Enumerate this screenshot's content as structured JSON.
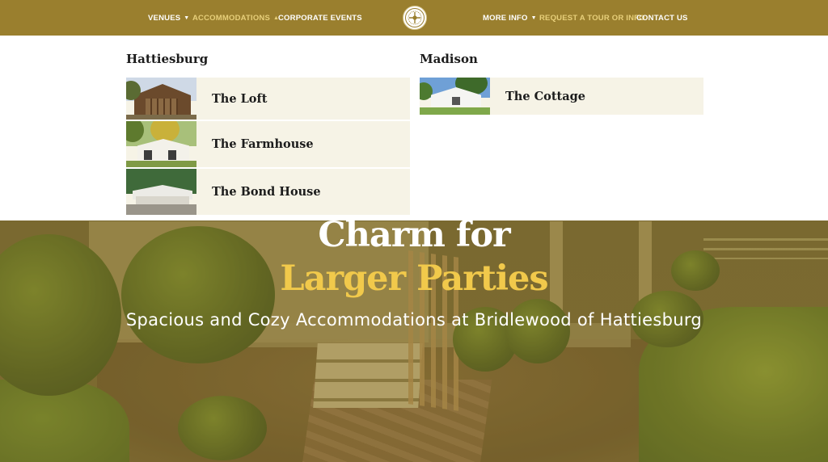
{
  "nav": {
    "left": [
      {
        "label": "VENUES",
        "caret": "▼"
      },
      {
        "label": "ACCOMMODATIONS",
        "caret": "▲"
      },
      {
        "label": "CORPORATE EVENTS"
      }
    ],
    "right": [
      {
        "label": "MORE INFO",
        "caret": "▼"
      },
      {
        "label": "REQUEST A TOUR OR INFO"
      },
      {
        "label": "CONTACT US"
      }
    ]
  },
  "mega_menu": {
    "regions": [
      {
        "title": "Hattiesburg",
        "items": [
          {
            "label": "The Loft"
          },
          {
            "label": "The Farmhouse"
          },
          {
            "label": "The Bond House"
          }
        ]
      },
      {
        "title": "Madison",
        "items": [
          {
            "label": "The Cottage"
          }
        ]
      }
    ]
  },
  "hero": {
    "line1": "Charm for",
    "line2": "Larger Parties",
    "subtitle": "Spacious and Cozy Accommodations at Bridlewood of Hattiesburg"
  },
  "colors": {
    "nav_bg": "#9a7f2e",
    "active_nav": "#e7cf7a",
    "accent_gold": "#f1c94b",
    "card_bg": "#f6f3e6"
  }
}
